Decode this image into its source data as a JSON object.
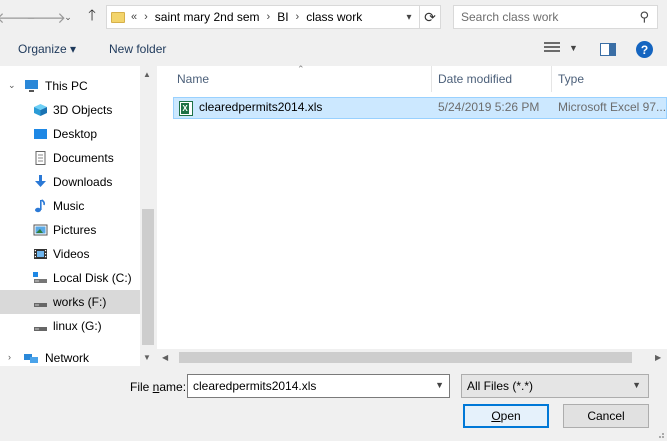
{
  "address": {
    "overflow": "«",
    "crumbs": [
      "saint mary 2nd sem",
      "BI",
      "class work"
    ]
  },
  "search": {
    "placeholder": "Search class work"
  },
  "toolbar": {
    "organize": "Organize ▾",
    "new_folder": "New folder",
    "help": "?"
  },
  "nav": {
    "this_pc": "This PC",
    "items": [
      {
        "label": "3D Objects",
        "icon": "3d-objects-icon"
      },
      {
        "label": "Desktop",
        "icon": "desktop-icon"
      },
      {
        "label": "Documents",
        "icon": "documents-icon"
      },
      {
        "label": "Downloads",
        "icon": "downloads-icon"
      },
      {
        "label": "Music",
        "icon": "music-icon"
      },
      {
        "label": "Pictures",
        "icon": "pictures-icon"
      },
      {
        "label": "Videos",
        "icon": "videos-icon"
      },
      {
        "label": "Local Disk (C:)",
        "icon": "drive-icon"
      },
      {
        "label": "works (F:)",
        "icon": "drive-icon"
      },
      {
        "label": "linux (G:)",
        "icon": "drive-icon"
      }
    ],
    "network": "Network"
  },
  "columns": {
    "name": "Name",
    "date": "Date modified",
    "type": "Type"
  },
  "files": [
    {
      "name": "clearedpermits2014.xls",
      "date": "5/24/2019 5:26 PM",
      "type": "Microsoft Excel 97..."
    }
  ],
  "footer": {
    "file_name_label_pre": "File ",
    "file_name_label_ul": "n",
    "file_name_label_post": "ame:",
    "file_name_value": "clearedpermits2014.xls",
    "filter": "All Files (*.*)",
    "open_ul": "O",
    "open_rest": "pen",
    "cancel": "Cancel"
  },
  "colors": {
    "selection": "#cce8ff",
    "accent": "#0078d7"
  }
}
